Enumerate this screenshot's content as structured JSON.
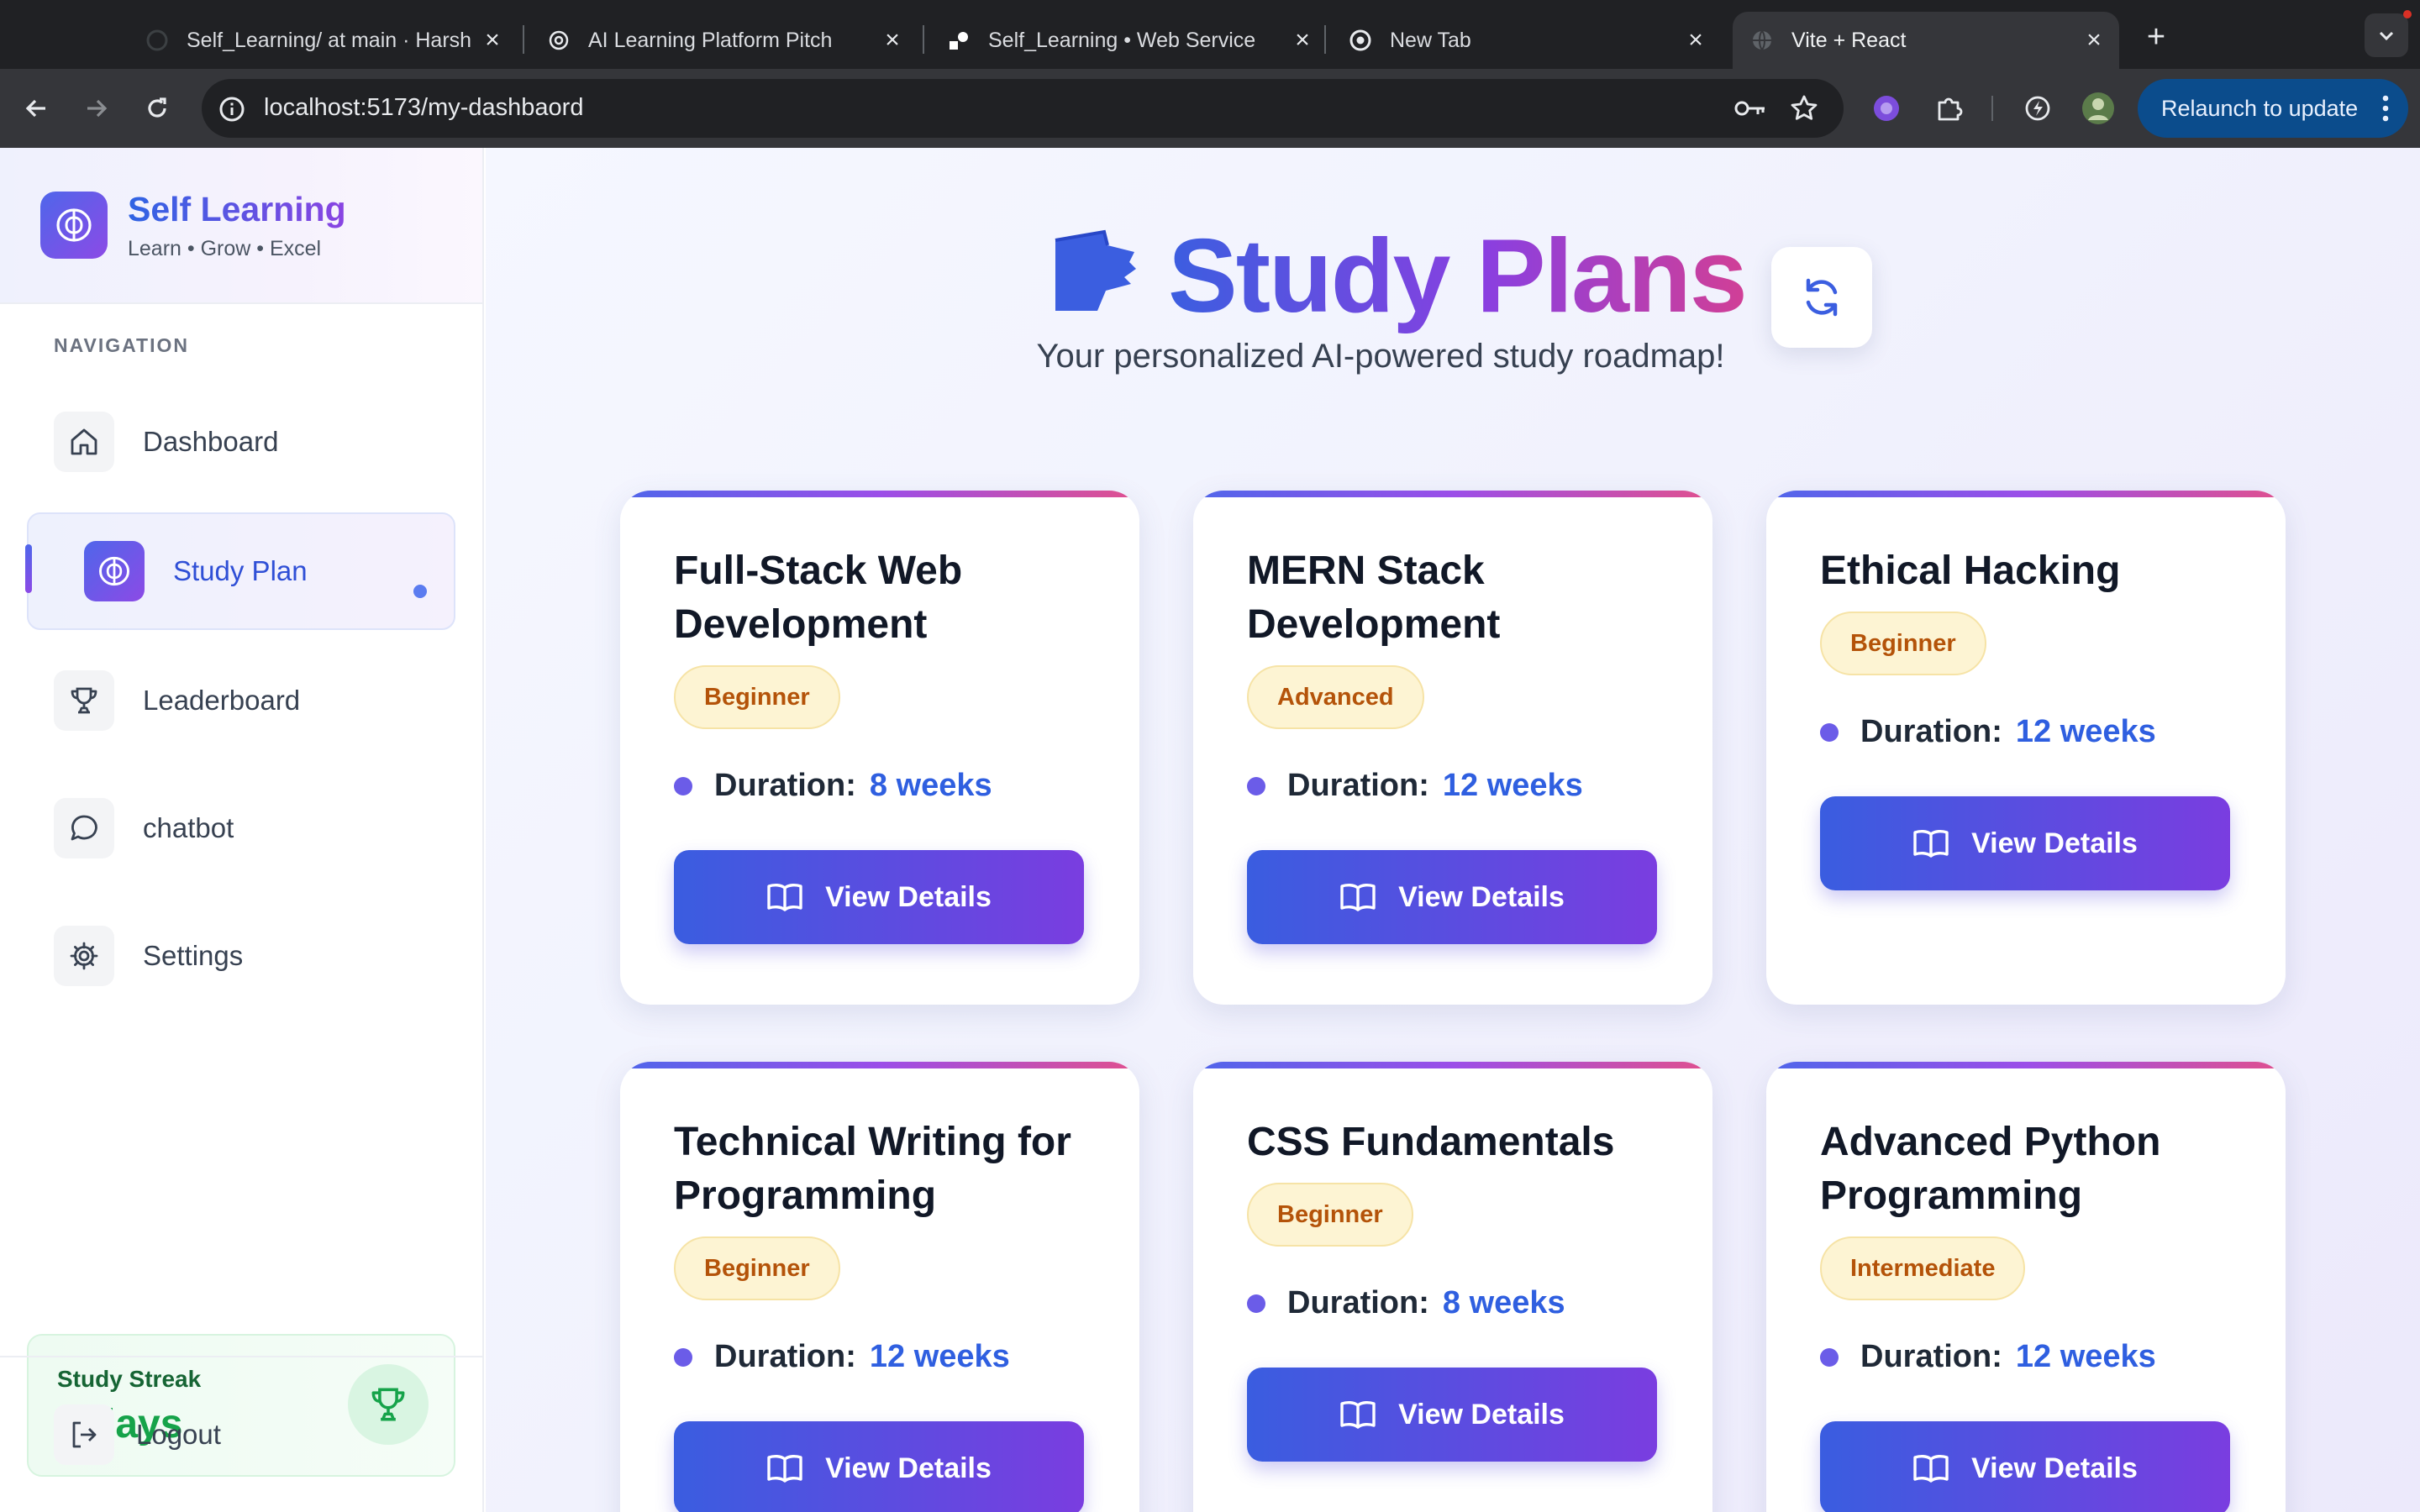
{
  "browser": {
    "tabs": [
      {
        "title": "Self_Learning/ at main · Harsh"
      },
      {
        "title": "AI Learning Platform Pitch"
      },
      {
        "title": "Self_Learning • Web Service"
      },
      {
        "title": "New Tab"
      },
      {
        "title": "Vite + React"
      }
    ],
    "url": "localhost:5173/my-dashbaord",
    "relaunch_label": "Relaunch to update"
  },
  "sidebar": {
    "brand_title": "Self Learning",
    "brand_subtitle": "Learn • Grow • Excel",
    "nav_header": "NAVIGATION",
    "items": [
      {
        "label": "Dashboard",
        "icon": "home-icon"
      },
      {
        "label": "Study Plan",
        "icon": "brain-icon",
        "active": true
      },
      {
        "label": "Leaderboard",
        "icon": "trophy-icon"
      },
      {
        "label": "chatbot",
        "icon": "chat-icon"
      },
      {
        "label": "Settings",
        "icon": "gear-icon"
      }
    ],
    "streak_label": "Study Streak",
    "streak_value": "7 days",
    "logout_label": "Logout"
  },
  "main": {
    "title": "Study Plans",
    "subtitle": "Your personalized AI-powered study roadmap!",
    "duration_label": "Duration:",
    "view_label": "View Details",
    "cards": [
      {
        "title": "Full-Stack Web Development",
        "level": "Beginner",
        "duration": "8 weeks"
      },
      {
        "title": "MERN Stack Development",
        "level": "Advanced",
        "duration": "12 weeks"
      },
      {
        "title": "Ethical Hacking",
        "level": "Beginner",
        "duration": "12 weeks"
      },
      {
        "title": "Technical Writing for Programming",
        "level": "Beginner",
        "duration": "12 weeks"
      },
      {
        "title": "CSS Fundamentals",
        "level": "Beginner",
        "duration": "8 weeks"
      },
      {
        "title": "Advanced Python Programming",
        "level": "Intermediate",
        "duration": "12 weeks"
      }
    ]
  },
  "colors": {
    "accent_blue": "#3a5de0",
    "accent_purple": "#7a3de0",
    "badge_bg": "#fdf4d3",
    "badge_text": "#b45309",
    "streak_green": "#16a34a"
  }
}
